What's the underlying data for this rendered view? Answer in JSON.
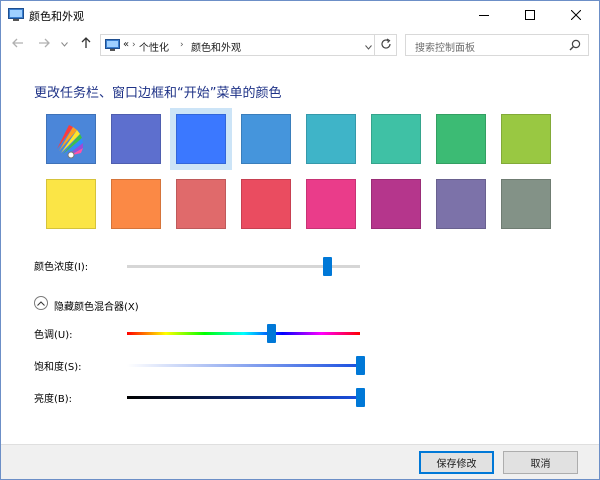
{
  "window": {
    "title": "颜色和外观",
    "controls": {
      "minimize": "minimize-icon",
      "maximize": "maximize-icon",
      "close": "close-icon"
    }
  },
  "nav": {
    "back_icon": "arrow-left-icon",
    "forward_icon": "arrow-right-icon",
    "recent_icon": "chevron-down-icon",
    "up_icon": "arrow-up-icon",
    "overflow": "«",
    "breadcrumb": [
      "个性化",
      "颜色和外观"
    ],
    "refresh_icon": "refresh-icon",
    "search_placeholder": "搜索控制面板"
  },
  "heading": "更改任务栏、窗口边框和“开始”菜单的颜色",
  "swatches": [
    {
      "id": "auto",
      "color": "auto",
      "selected": false
    },
    {
      "id": "c2",
      "color": "#5d6fce",
      "selected": false
    },
    {
      "id": "c3",
      "color": "#3b78ff",
      "selected": true
    },
    {
      "id": "c4",
      "color": "#4595dc",
      "selected": false
    },
    {
      "id": "c5",
      "color": "#3fb4c8",
      "selected": false
    },
    {
      "id": "c6",
      "color": "#3fc1a5",
      "selected": false
    },
    {
      "id": "c7",
      "color": "#3cbb74",
      "selected": false
    },
    {
      "id": "c8",
      "color": "#99c842",
      "selected": false
    },
    {
      "id": "c9",
      "color": "#fbe546",
      "selected": false
    },
    {
      "id": "c10",
      "color": "#fb8945",
      "selected": false
    },
    {
      "id": "c11",
      "color": "#e06a6b",
      "selected": false
    },
    {
      "id": "c12",
      "color": "#ea4c60",
      "selected": false
    },
    {
      "id": "c13",
      "color": "#ea3c8a",
      "selected": false
    },
    {
      "id": "c14",
      "color": "#b5368c",
      "selected": false
    },
    {
      "id": "c15",
      "color": "#7c72a9",
      "selected": false
    },
    {
      "id": "c16",
      "color": "#839287",
      "selected": false
    }
  ],
  "intensity": {
    "label": "颜色浓度(I):",
    "value": 0.86
  },
  "mixer": {
    "toggle_label": "隐藏颜色混合器(X)",
    "expanded": true
  },
  "hue": {
    "label": "色调(U):",
    "value": 0.62
  },
  "saturation": {
    "label": "饱和度(S):",
    "value": 1.0
  },
  "brightness": {
    "label": "亮度(B):",
    "value": 1.0
  },
  "buttons": {
    "save": "保存修改",
    "cancel": "取消"
  },
  "colors": {
    "accent": "#0078d7",
    "heading": "#1e3287",
    "selected_bg": "#cce4f7"
  }
}
